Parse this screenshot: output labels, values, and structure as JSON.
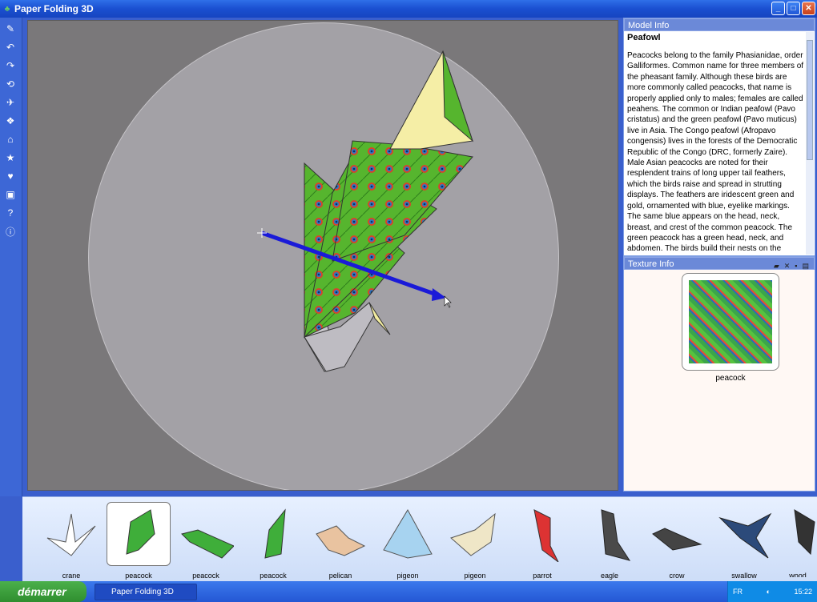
{
  "window": {
    "title": "Paper Folding 3D"
  },
  "title_buttons": {
    "minimize": "_",
    "maximize": "□",
    "close": "✕"
  },
  "toolbar": {
    "icons": [
      "brush-icon",
      "undo-icon",
      "redo-icon",
      "fold-icon",
      "bird-icon",
      "model-icon",
      "home-icon",
      "star-icon",
      "heart-icon",
      "camera-icon",
      "help-icon",
      "info-icon"
    ]
  },
  "model_info": {
    "header": "Model Info",
    "name": "Peafowl",
    "description": "Peacocks belong to the family Phasianidae, order Galliformes. Common name for three members of the pheasant family. Although these birds are more commonly called peacocks, that name is properly applied only to males; females are called peahens. The common or Indian peafowl (Pavo cristatus) and the green peafowl (Pavo muticus) live in Asia. The Congo peafowl (Afropavo congensis) lives in the forests of the Democratic Republic of the Congo (DRC, formerly Zaire). Male Asian peacocks are noted for their resplendent trains of long upper tail feathers, which the birds raise and spread in strutting displays. The feathers are iridescent green and gold, ornamented with blue, eyelike markings. The same blue appears on the head, neck, breast, and crest of the common peacock. The green peacock has a green head, neck, and abdomen. The birds build their nests on the"
  },
  "texture_info": {
    "header": "Texture Info",
    "label": "peacock"
  },
  "models": [
    {
      "label": "crane"
    },
    {
      "label": "peacock"
    },
    {
      "label": "peacock"
    },
    {
      "label": "peacock"
    },
    {
      "label": "pelican"
    },
    {
      "label": "pigeon"
    },
    {
      "label": "pigeon"
    },
    {
      "label": "parrot"
    },
    {
      "label": "eagle"
    },
    {
      "label": "crow"
    },
    {
      "label": "swallow"
    },
    {
      "label": "wood"
    }
  ],
  "taskbar": {
    "start": "démarrer",
    "task": "Paper Folding 3D",
    "lang": "FR",
    "clock": "15:22"
  },
  "colors": {
    "accent": "#3a5fcd",
    "arrow": "#1a1ad8",
    "viewport": "#7a787a"
  }
}
